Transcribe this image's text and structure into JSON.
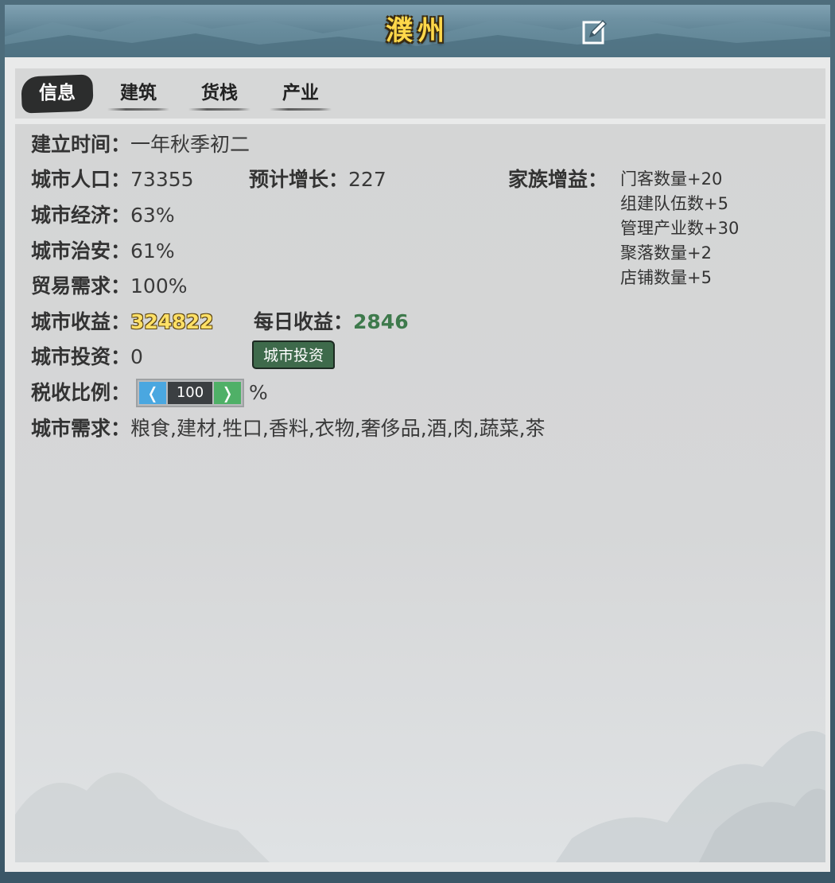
{
  "window": {
    "title": "濮州"
  },
  "tabs": [
    {
      "label": "信息",
      "active": true
    },
    {
      "label": "建筑",
      "active": false
    },
    {
      "label": "货栈",
      "active": false
    },
    {
      "label": "产业",
      "active": false
    }
  ],
  "info": {
    "founded": {
      "label": "建立时间：",
      "value": "一年秋季初二"
    },
    "population": {
      "label": "城市人口：",
      "value": "73355"
    },
    "growth": {
      "label": "预计增长：",
      "value": "227"
    },
    "family_bonus": {
      "label": "家族增益：",
      "items": [
        "门客数量+20",
        "组建队伍数+5",
        "管理产业数+30",
        "聚落数量+2",
        "店铺数量+5"
      ]
    },
    "economy": {
      "label": "城市经济：",
      "value": "63%"
    },
    "security": {
      "label": "城市治安：",
      "value": "61%"
    },
    "trade_demand": {
      "label": "贸易需求：",
      "value": "100%"
    },
    "revenue": {
      "label": "城市收益：",
      "value": "324822"
    },
    "daily_revenue": {
      "label": "每日收益：",
      "value": "2846"
    },
    "investment": {
      "label": "城市投资：",
      "value": "0",
      "button_label": "城市投资"
    },
    "tax_rate": {
      "label": "税收比例：",
      "value": "100",
      "unit": "%",
      "dec_glyph": "❬",
      "inc_glyph": "❭"
    },
    "demands": {
      "label": "城市需求：",
      "value": "粮食,建材,牲口,香料,衣物,奢侈品,酒,肉,蔬菜,茶"
    }
  },
  "colors": {
    "title": "#ffd84a",
    "revenue": "#ffe066",
    "daily_revenue": "#3e7a4c",
    "invest_button": "#3e6a4b",
    "step_dec": "#4aa7e0",
    "step_inc": "#4fb067"
  },
  "icons": {
    "edit": "edit-icon",
    "decrease": "chevron-left-icon",
    "increase": "chevron-right-icon"
  }
}
